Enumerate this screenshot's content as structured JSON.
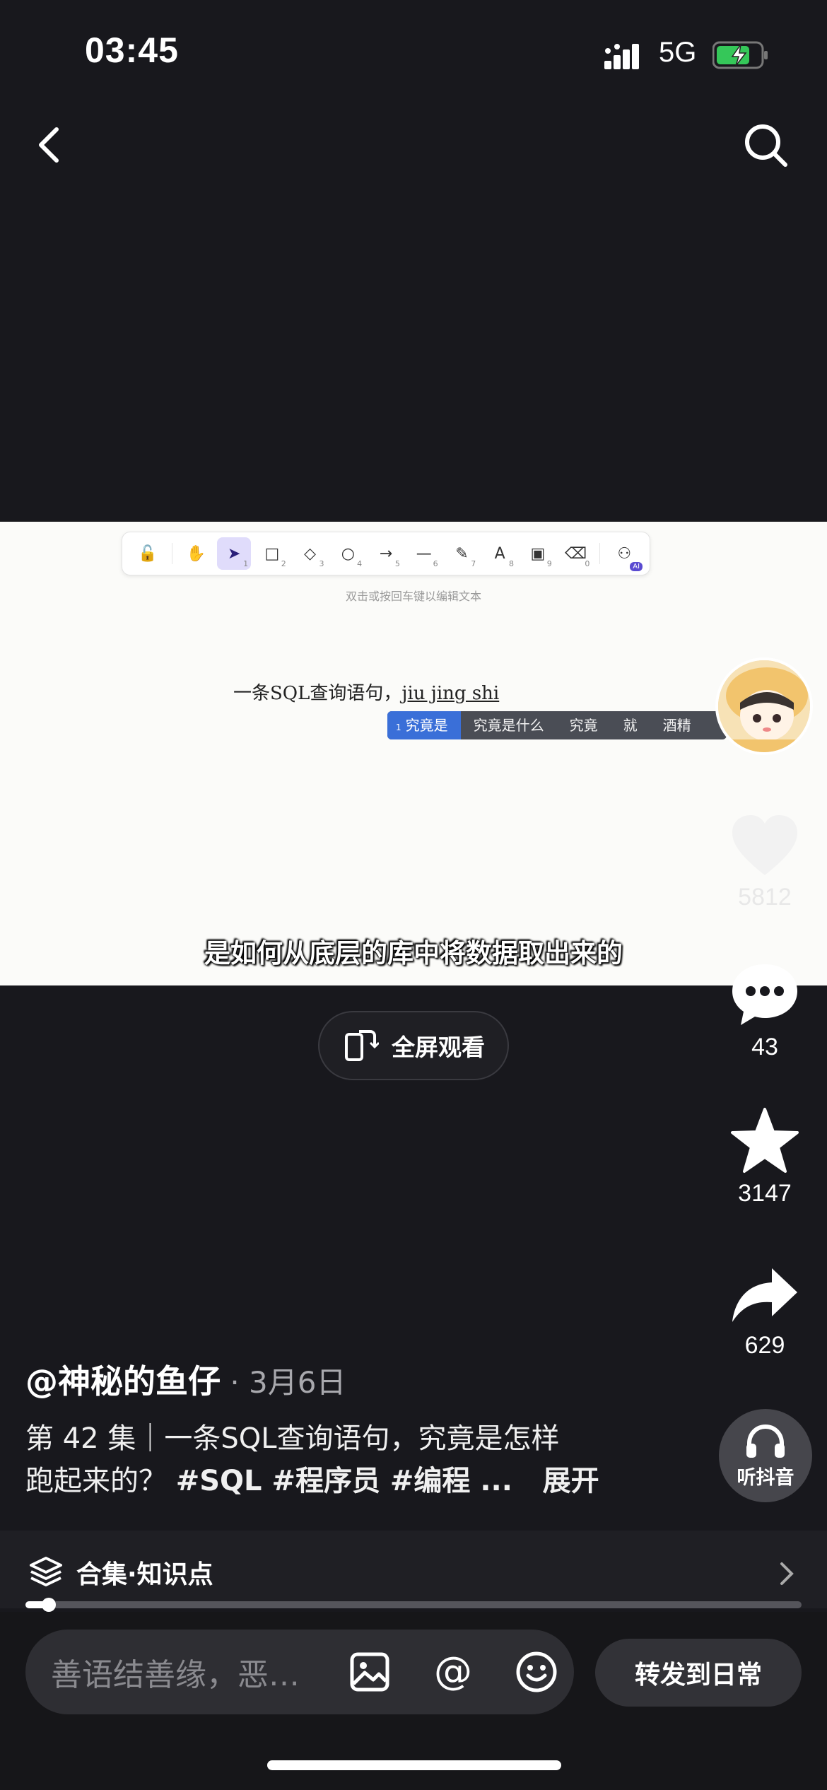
{
  "status_bar": {
    "time": "03:45",
    "network": "5G"
  },
  "video": {
    "hint": "双击或按回车键以编辑文本",
    "handwriting_prefix": "一条SQL查询语句，",
    "handwriting_typed": "jiu jing shi",
    "ime_candidates": [
      "究竟是",
      "究竟是什么",
      "究竟",
      "就",
      "酒精"
    ],
    "ime_index": "1",
    "subtitle": "是如何从底层的库中将数据取出来的"
  },
  "fullscreen": {
    "label": "全屏观看"
  },
  "rail": {
    "likes": "5812",
    "comments": "43",
    "favorites": "3147",
    "shares": "629",
    "listen_label": "听抖音"
  },
  "caption": {
    "author": "@神秘的鱼仔",
    "date": " · 3月6日",
    "line1": "第 42 集｜一条SQL查询语句，究竟是怎样",
    "line2_text": "跑起来的？ ",
    "tags": "#SQL #程序员 #编程 ...",
    "expand": "展开"
  },
  "collection": {
    "label": "合集·知识点",
    "progress": 0.03
  },
  "bottom": {
    "comment_placeholder": "善语结善缘，恶…",
    "share_daily": "转发到日常"
  },
  "colors": {
    "accent_green": "#35c759",
    "ime_selected": "#3a6fd8"
  }
}
